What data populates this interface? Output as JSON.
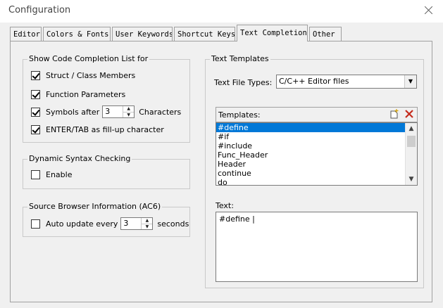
{
  "window": {
    "title": "Configuration"
  },
  "tabs": [
    {
      "label": "Editor"
    },
    {
      "label": "Colors & Fonts"
    },
    {
      "label": "User Keywords"
    },
    {
      "label": "Shortcut Keys"
    },
    {
      "label": "Text Completion"
    },
    {
      "label": "Other"
    }
  ],
  "active_tab": "Text Completion",
  "completion": {
    "group_title": "Show Code Completion List for",
    "struct_members": {
      "label": "Struct / Class Members",
      "checked": true
    },
    "function_params": {
      "label": "Function Parameters",
      "checked": true
    },
    "symbols_after": {
      "label": "Symbols after",
      "value": "3",
      "suffix": "Characters",
      "checked": true
    },
    "enter_tab": {
      "label": "ENTER/TAB as fill-up character",
      "checked": true
    }
  },
  "syntax": {
    "group_title": "Dynamic Syntax Checking",
    "enable": {
      "label": "Enable",
      "checked": false
    }
  },
  "browser": {
    "group_title": "Source Browser Information (AC6)",
    "auto_update": {
      "label": "Auto update every",
      "value": "3",
      "suffix": "seconds",
      "checked": false
    }
  },
  "templates": {
    "group_title": "Text Templates",
    "file_types_label": "Text File Types:",
    "file_types_value": "C/C++ Editor files",
    "list_label": "Templates:",
    "new_icon": "new-template-icon",
    "delete_icon": "delete-template-icon",
    "items": [
      "#define",
      "#if",
      "#include",
      "Func_Header",
      "Header",
      "continue",
      "do"
    ],
    "selected_index": 0,
    "text_label": "Text:",
    "text_value": "#define |"
  },
  "colors": {
    "selection": "#0078d7",
    "delete_icon": "#c42b1c"
  }
}
